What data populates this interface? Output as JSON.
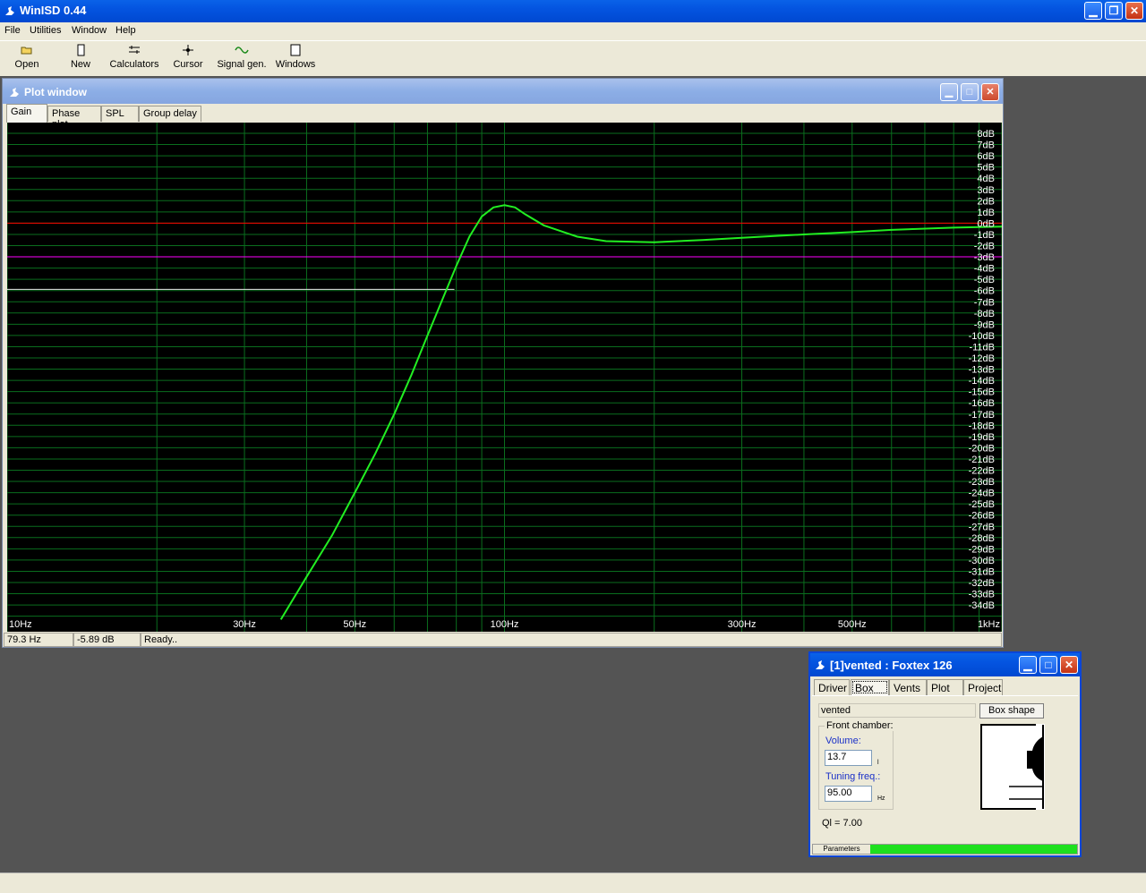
{
  "app": {
    "title": "WinISD 0.44"
  },
  "menu": [
    "File",
    "Utilities",
    "Window",
    "Help"
  ],
  "toolbar": [
    {
      "label": "Open",
      "icon": "folder-icon"
    },
    {
      "label": "New",
      "icon": "new-document-icon"
    },
    {
      "label": "Calculators",
      "icon": "calculator-icon"
    },
    {
      "label": "Cursor",
      "icon": "cursor-icon"
    },
    {
      "label": "Signal gen.",
      "icon": "signal-generator-icon"
    },
    {
      "label": "Windows",
      "icon": "windows-icon"
    }
  ],
  "plot_window": {
    "title": "Plot window",
    "tabs": [
      "Gain",
      "Phase plot",
      "SPL",
      "Group delay"
    ],
    "active_tab": "Gain",
    "status": {
      "freq": "79.3 Hz",
      "db": "-5.89 dB",
      "message": "Ready.."
    }
  },
  "chart_data": {
    "type": "line",
    "x_scale": "log",
    "xlim": [
      10,
      1000
    ],
    "ylim": [
      -35,
      8
    ],
    "x_tick_labels": [
      "10Hz",
      "30Hz",
      "50Hz",
      "100Hz",
      "300Hz",
      "500Hz",
      "1kHz"
    ],
    "x_tick_values": [
      10,
      30,
      50,
      100,
      300,
      500,
      1000
    ],
    "y_tick_labels": [
      "8dB",
      "7dB",
      "6dB",
      "5dB",
      "4dB",
      "3dB",
      "2dB",
      "1dB",
      "0dB",
      "-1dB",
      "-2dB",
      "-3dB",
      "-4dB",
      "-5dB",
      "-6dB",
      "-7dB",
      "-8dB",
      "-9dB",
      "-10dB",
      "-11dB",
      "-12dB",
      "-13dB",
      "-14dB",
      "-15dB",
      "-16dB",
      "-17dB",
      "-18dB",
      "-19dB",
      "-20dB",
      "-21dB",
      "-22dB",
      "-23dB",
      "-24dB",
      "-25dB",
      "-26dB",
      "-27dB",
      "-28dB",
      "-29dB",
      "-30dB",
      "-31dB",
      "-32dB",
      "-33dB",
      "-34dB"
    ],
    "y_tick_values": [
      8,
      7,
      6,
      5,
      4,
      3,
      2,
      1,
      0,
      -1,
      -2,
      -3,
      -4,
      -5,
      -6,
      -7,
      -8,
      -9,
      -10,
      -11,
      -12,
      -13,
      -14,
      -15,
      -16,
      -17,
      -18,
      -19,
      -20,
      -21,
      -22,
      -23,
      -24,
      -25,
      -26,
      -27,
      -28,
      -29,
      -30,
      -31,
      -32,
      -33,
      -34
    ],
    "grid": true,
    "reference_lines": [
      {
        "db": 0,
        "color": "#ff0000"
      },
      {
        "db": -3,
        "color": "#ff00ff"
      }
    ],
    "cursor": {
      "freq": 79.3,
      "db": -5.89
    },
    "series": [
      {
        "color": "#22ee22",
        "x": [
          35.5,
          40,
          45,
          50,
          55,
          60,
          65,
          70,
          75,
          80,
          85,
          90,
          95,
          100,
          105,
          110,
          120,
          140,
          160,
          200,
          250,
          300,
          400,
          500,
          600,
          800,
          1000
        ],
        "y": [
          -35.3,
          -31.5,
          -27.8,
          -24.0,
          -20.5,
          -17.0,
          -13.5,
          -10.0,
          -6.8,
          -3.8,
          -1.2,
          0.6,
          1.4,
          1.6,
          1.4,
          0.8,
          -0.2,
          -1.2,
          -1.6,
          -1.7,
          -1.5,
          -1.3,
          -1.0,
          -0.8,
          -0.6,
          -0.4,
          -0.3
        ]
      }
    ]
  },
  "box_window": {
    "title": "[1]vented : Foxtex 126",
    "tabs": [
      "Driver",
      "Box",
      "Vents",
      "Plot",
      "Project"
    ],
    "active_tab": "Box",
    "box_type": "vented",
    "box_shape_button": "Box shape",
    "front_chamber_label": "Front chamber:",
    "volume_label": "Volume:",
    "volume_value": "13.7",
    "volume_unit": "l",
    "tuning_label": "Tuning freq.:",
    "tuning_value": "95.00",
    "tuning_unit": "Hz",
    "ql_text": "Ql = 7.00",
    "parameters_label": "Parameters",
    "parameters_progress": 1.0
  },
  "colors": {
    "plot_background": "#000000",
    "grid": "#0a6e1e",
    "curve": "#22ee22",
    "titlebar": "#0454e0"
  }
}
